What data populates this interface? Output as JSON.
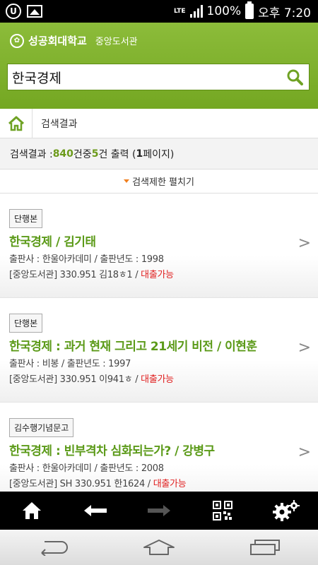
{
  "status_bar": {
    "network": "LTE",
    "battery": "100%",
    "time": "오후 7:20",
    "icons": [
      "u-plus-icon",
      "gallery-icon",
      "signal-icon",
      "battery-icon"
    ]
  },
  "header": {
    "university": "성공회대학교",
    "library": "중앙도서관",
    "search_value": "한국경제",
    "search_icon": "search-icon",
    "accent": "#7aad2a"
  },
  "breadcrumb": {
    "home_icon": "home-icon",
    "label": "검색결과"
  },
  "summary": {
    "label": "검색결과 : ",
    "total": "840",
    "total_unit": "건중 ",
    "shown": "5",
    "shown_unit": "건 출력 (",
    "pages": "1",
    "pages_unit": "페이지)"
  },
  "filter_toggle": "검색제한 펼치기",
  "results": [
    {
      "badge": "단행본",
      "title": "한국경제 / 김기태",
      "publisher": "출판사 : 한울아카데미 / 출판년도 : 1998",
      "call_number": "[중앙도서관] 330.951 김18ㅎ1 / ",
      "availability": "대출가능"
    },
    {
      "badge": "단행본",
      "title": "한국경제 : 과거 현재 그리고 21세기 비전 / 이현훈",
      "publisher": "출판사 : 비봉 / 출판년도 : 1997",
      "call_number": "[중앙도서관] 330.951 이941ㅎ / ",
      "availability": "대출가능"
    },
    {
      "badge": "김수행기념문고",
      "title": "한국경제 : 빈부격차 심화되는가? / 강병구",
      "publisher": "출판사 : 한울아카데미 / 출판년도 : 2008",
      "call_number": "[중앙도서관] SH 330.951 한1624 / ",
      "availability": "대출가능"
    }
  ],
  "toolbar": [
    "home-icon",
    "back-arrow-icon",
    "forward-arrow-icon",
    "qr-code-icon",
    "settings-icon"
  ],
  "android_nav": [
    "back-icon",
    "home-icon",
    "recent-apps-icon"
  ]
}
